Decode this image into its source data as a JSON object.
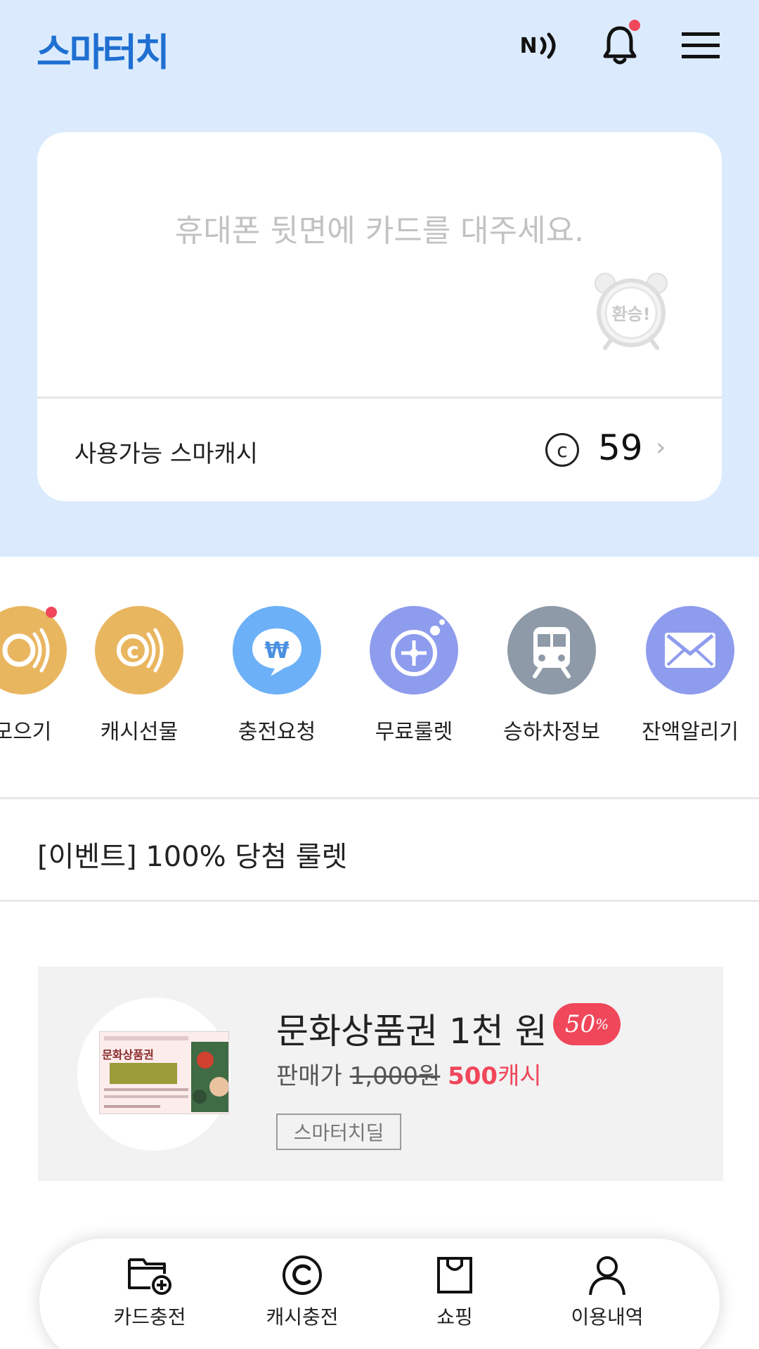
{
  "header": {
    "logo": "스마터치",
    "nfc_label": "N",
    "icons": [
      "nfc-icon",
      "bell-icon",
      "menu-icon"
    ]
  },
  "card": {
    "message": "휴대폰 뒷면에 카드를 대주세요.",
    "transfer_alarm_label": "환승!",
    "available_label": "사용가능 스마캐시",
    "coin_symbol": "c",
    "available_value": "59",
    "arrow": "›"
  },
  "quick_menu": [
    {
      "label": "모으기",
      "color": "#e9b660",
      "icon": "cash-collect-icon",
      "badge": true
    },
    {
      "label": "캐시선물",
      "color": "#e9b660",
      "icon": "cash-gift-icon"
    },
    {
      "label": "충전요청",
      "color": "#6cb0f7",
      "icon": "charge-request-icon",
      "symbol": "₩"
    },
    {
      "label": "무료룰렛",
      "color": "#8e9cee",
      "icon": "roulette-icon"
    },
    {
      "label": "승하차정보",
      "color": "#8f9aa8",
      "icon": "train-icon"
    },
    {
      "label": "잔액알리기",
      "color": "#8e9cee",
      "icon": "mail-icon"
    }
  ],
  "event": {
    "title": "[이벤트] 100% 당첨 룰렛"
  },
  "promo": {
    "title": "문화상품권 1천 원",
    "discount": "50",
    "discount_unit": "%",
    "price_label": "판매가 ",
    "original_price": "1,000원",
    "sale_amount": "500",
    "sale_unit": "캐시",
    "tag": "스마터치딜",
    "voucher_text": "문화상품권"
  },
  "bottom_nav": [
    {
      "label": "카드충전",
      "icon": "card-charge-icon"
    },
    {
      "label": "캐시충전",
      "icon": "cash-charge-icon"
    },
    {
      "label": "쇼핑",
      "icon": "shopping-bag-icon"
    },
    {
      "label": "이용내역",
      "icon": "user-icon"
    }
  ],
  "colors": {
    "background_top": "#dbebfd",
    "logo": "#1f6fd1",
    "accent_red": "#f0475b"
  }
}
